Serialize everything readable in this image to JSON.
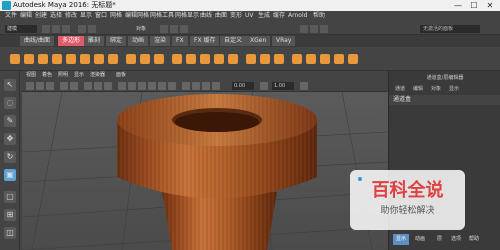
{
  "window": {
    "title": "Autodesk Maya 2016: 无标题*"
  },
  "window_controls": [
    "—",
    "☐",
    "✕"
  ],
  "menubar": [
    "文件",
    "编辑",
    "创建",
    "选择",
    "修改",
    "显示",
    "窗口",
    "网格",
    "编辑网格",
    "网格工具",
    "网格显示",
    "曲线",
    "曲面",
    "变形",
    "UV",
    "生成",
    "缓存",
    "Arnold",
    "帮助"
  ],
  "status_line": {
    "mode_select": "建模",
    "object_label": "对象",
    "search_placeholder": "无激活的面板"
  },
  "shelf": {
    "tabs": [
      "曲线/曲面",
      "多边形",
      "雕刻",
      "绑定",
      "动画",
      "渲染",
      "FX",
      "FX 缓存",
      "自定义",
      "XGen",
      "VRay"
    ],
    "active_tab_index": 1
  },
  "viewport": {
    "menu": [
      "视图",
      "着色",
      "照明",
      "显示",
      "渲染器",
      "面板"
    ],
    "field_1": "0.00",
    "field_2": "1.00"
  },
  "right_panel": {
    "title": "通道盒/层编辑器",
    "menu": [
      "通道",
      "编辑",
      "对象",
      "显示"
    ],
    "tabs": [
      "通道盒"
    ],
    "bottom_tabs": [
      "显示",
      "动画"
    ],
    "bottom_extra": [
      "层",
      "选项",
      "帮助"
    ]
  },
  "watermark": {
    "title": "百科全说",
    "subtitle": "助你轻松解决"
  },
  "colors": {
    "accent": "#e05a6a",
    "shelf_icon": "#e8973a",
    "tool_active": "#5ba3d6"
  }
}
